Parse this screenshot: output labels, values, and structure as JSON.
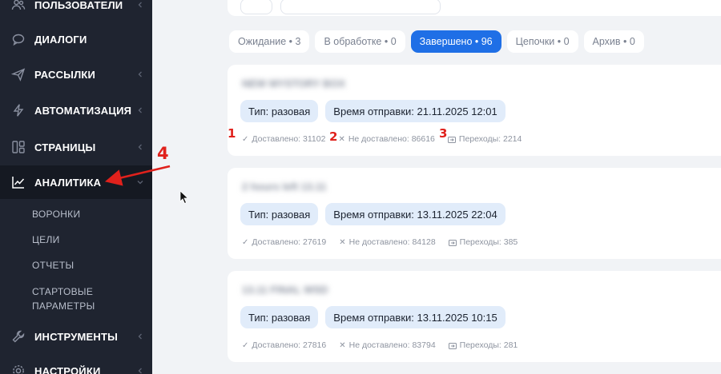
{
  "sidebar": {
    "items": [
      {
        "label": "ПОЛЬЗОВАТЕЛИ",
        "icon": "users-icon"
      },
      {
        "label": "ДИАЛОГИ",
        "icon": "chat-icon"
      },
      {
        "label": "РАССЫЛКИ",
        "icon": "send-icon"
      },
      {
        "label": "АВТОМАТИЗАЦИЯ",
        "icon": "lightning-icon"
      },
      {
        "label": "СТРАНИЦЫ",
        "icon": "pages-icon"
      },
      {
        "label": "АНАЛИТИКА",
        "icon": "chart-line-icon"
      },
      {
        "label": "ИНСТРУМЕНТЫ",
        "icon": "wrench-icon"
      },
      {
        "label": "НАСТРОЙКИ",
        "icon": "gear-icon"
      }
    ],
    "analytics_sub": [
      "ВОРОНКИ",
      "ЦЕЛИ",
      "ОТЧЕТЫ",
      "СТАРТОВЫЕ ПАРАМЕТРЫ"
    ]
  },
  "tabs": [
    {
      "label": "Ожидание • 3",
      "active": false
    },
    {
      "label": "В обработке • 0",
      "active": false
    },
    {
      "label": "Завершено • 96",
      "active": true
    },
    {
      "label": "Цепочки • 0",
      "active": false
    },
    {
      "label": "Архив • 0",
      "active": false
    }
  ],
  "cards": [
    {
      "title": "NEW MYSTORY BOX",
      "type": "Тип: разовая",
      "send_time": "Время отправки: 21.11.2025 12:01",
      "delivered": "Доставлено: 31102",
      "not_delivered": "Не доставлено: 86616",
      "clicks": "Переходы: 2214"
    },
    {
      "title": "2 hours left 13.11",
      "type": "Тип: разовая",
      "send_time": "Время отправки: 13.11.2025 22:04",
      "delivered": "Доставлено: 27619",
      "not_delivered": "Не доставлено: 84128",
      "clicks": "Переходы: 385"
    },
    {
      "title": "13.11 FINAL WSD",
      "type": "Тип: разовая",
      "send_time": "Время отправки: 13.11.2025 10:15",
      "delivered": "Доставлено: 27816",
      "not_delivered": "Не доставлено: 83794",
      "clicks": "Переходы: 281"
    }
  ],
  "annotations": {
    "m1": "1",
    "m2": "2",
    "m3": "3",
    "m4": "4"
  },
  "colors": {
    "sidebar": "#1f2430",
    "accent": "#1f6fe6",
    "chip": "#e1ecfa",
    "annotation": "#e0211c"
  }
}
